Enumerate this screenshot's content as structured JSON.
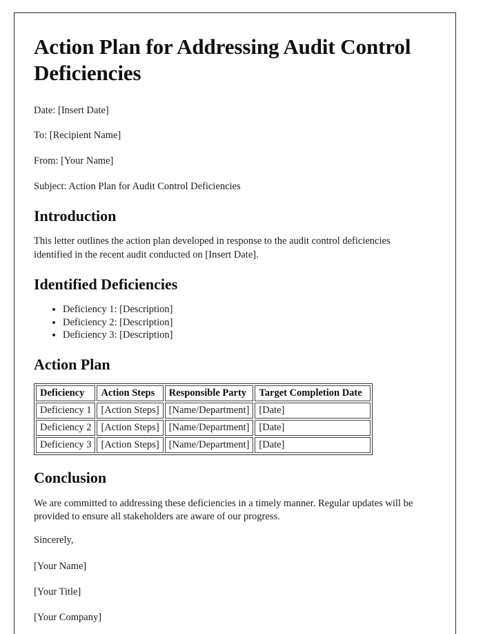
{
  "document": {
    "title": "Action Plan for Addressing Audit Control Deficiencies",
    "meta": {
      "date": "Date: [Insert Date]",
      "to": "To: [Recipient Name]",
      "from": "From: [Your Name]",
      "subject": "Subject: Action Plan for Audit Control Deficiencies"
    },
    "introduction": {
      "heading": "Introduction",
      "paragraph": "This letter outlines the action plan developed in response to the audit control deficiencies identified in the recent audit conducted on [Insert Date]."
    },
    "identified_deficiencies": {
      "heading": "Identified Deficiencies",
      "items": [
        "Deficiency 1: [Description]",
        "Deficiency 2: [Description]",
        "Deficiency 3: [Description]"
      ]
    },
    "action_plan": {
      "heading": "Action Plan",
      "table": {
        "columns": [
          "Deficiency",
          "Action Steps",
          "Responsible Party",
          "Target Completion Date"
        ],
        "rows": [
          {
            "deficiency": "Deficiency 1",
            "action_steps": "[Action Steps]",
            "responsible_party": "[Name/Department]",
            "target_completion_date": "[Date]"
          },
          {
            "deficiency": "Deficiency 2",
            "action_steps": "[Action Steps]",
            "responsible_party": "[Name/Department]",
            "target_completion_date": "[Date]"
          },
          {
            "deficiency": "Deficiency 3",
            "action_steps": "[Action Steps]",
            "responsible_party": "[Name/Department]",
            "target_completion_date": "[Date]"
          }
        ]
      }
    },
    "conclusion": {
      "heading": "Conclusion",
      "paragraph": "We are committed to addressing these deficiencies in a timely manner. Regular updates will be provided to ensure all stakeholders are aware of our progress.",
      "closing": "Sincerely,",
      "signature_lines": [
        "[Your Name]",
        "[Your Title]",
        "[Your Company]"
      ]
    },
    "colors": {
      "page_background": "#ffffff",
      "page_border": "#2b2b2b",
      "heading_text": "#12100f",
      "body_text": "#1b1b1b",
      "table_border": "#444444"
    }
  }
}
